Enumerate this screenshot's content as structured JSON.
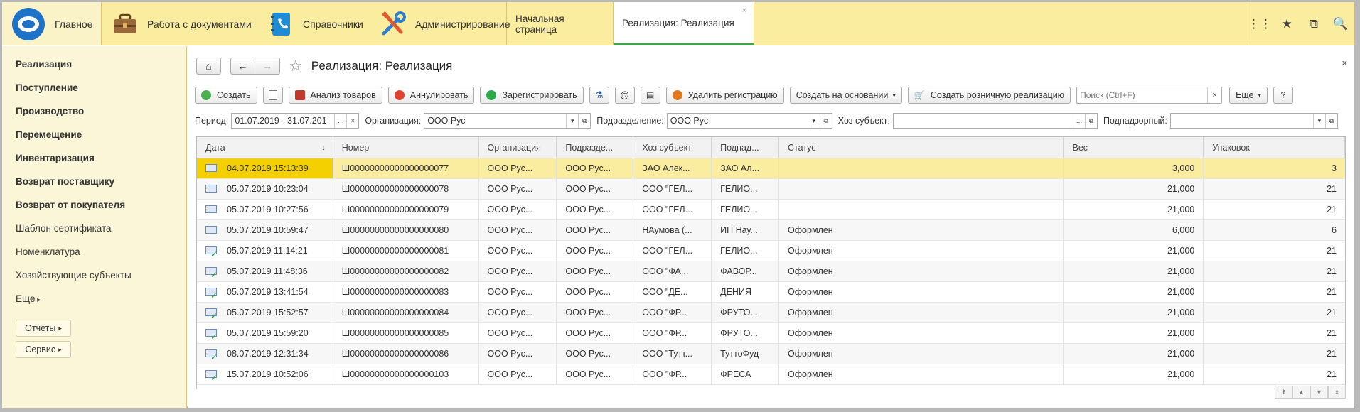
{
  "topbar": {
    "sections": [
      {
        "label": "Главное",
        "icon": "logo-icon"
      },
      {
        "label": "Работа с документами",
        "icon": "briefcase-icon"
      },
      {
        "label": "Справочники",
        "icon": "phonebook-icon"
      },
      {
        "label": "Администрирование",
        "icon": "tools-icon"
      }
    ],
    "open_tabs": [
      {
        "label": "Начальная страница"
      },
      {
        "label": "Реализация: Реализация",
        "close": "×"
      }
    ],
    "right_icons": [
      "grid-icon",
      "star-icon",
      "history-icon",
      "search-icon"
    ],
    "right_glyphs": [
      "⋮⋮",
      "★",
      "⧉",
      "🔍"
    ]
  },
  "sidebar": {
    "items": [
      {
        "label": "Реализация",
        "bold": true
      },
      {
        "label": "Поступление",
        "bold": true
      },
      {
        "label": "Производство",
        "bold": true
      },
      {
        "label": "Перемещение",
        "bold": true
      },
      {
        "label": "Инвентаризация",
        "bold": true
      },
      {
        "label": "Возврат поставщику",
        "bold": true
      },
      {
        "label": "Возврат от покупателя",
        "bold": true
      },
      {
        "label": "Шаблон сертификата",
        "bold": false
      },
      {
        "label": "Номенклатура",
        "bold": false
      },
      {
        "label": "Хозяйствующие субъекты",
        "bold": false
      }
    ],
    "more_label": "Еще",
    "reports_label": "Отчеты",
    "service_label": "Сервис"
  },
  "main": {
    "title": "Реализация: Реализация",
    "close": "×",
    "commands": {
      "create": "Создать",
      "analyze": "Анализ товаров",
      "cancel": "Аннулировать",
      "register": "Зарегистрировать",
      "email": "@",
      "delete_reg": "Удалить регистрацию",
      "create_based": "Создать на основании",
      "create_retail": "Создать розничную реализацию",
      "more": "Еще",
      "help": "?"
    },
    "search": {
      "placeholder": "Поиск (Ctrl+F)",
      "clear": "×"
    },
    "filters": {
      "period_label": "Период:",
      "period_value": "01.07.2019 - 31.07.201",
      "org_label": "Организация:",
      "org_value": "ООО Рус",
      "div_label": "Подразделение:",
      "div_value": "ООО Рус",
      "subject_label": "Хоз субъект:",
      "subject_value": "",
      "supervised_label": "Поднадзорный:",
      "supervised_value": ""
    },
    "columns": [
      "Дата",
      "Номер",
      "Организация",
      "Подразде...",
      "Хоз субъект",
      "Поднад...",
      "Статус",
      "Вес",
      "Упаковок"
    ],
    "sort_glyph": "↓",
    "rows": [
      {
        "date": "04.07.2019 15:13:39",
        "num": "Ш00000000000000000077",
        "org": "ООО Рус...",
        "div": "ООО Рус...",
        "sub": "ЗАО  Алек...",
        "sup": "ЗАО Ал...",
        "status": "",
        "weight": "3,000",
        "packs": "3",
        "posted": false,
        "selected": true
      },
      {
        "date": "05.07.2019 10:23:04",
        "num": "Ш00000000000000000078",
        "org": "ООО Рус...",
        "div": "ООО Рус...",
        "sub": "ООО \"ГЕЛ...",
        "sup": "ГЕЛИО...",
        "status": "",
        "weight": "21,000",
        "packs": "21",
        "posted": false
      },
      {
        "date": "05.07.2019 10:27:56",
        "num": "Ш00000000000000000079",
        "org": "ООО Рус...",
        "div": "ООО Рус...",
        "sub": "ООО \"ГЕЛ...",
        "sup": "ГЕЛИО...",
        "status": "",
        "weight": "21,000",
        "packs": "21",
        "posted": false
      },
      {
        "date": "05.07.2019 10:59:47",
        "num": "Ш00000000000000000080",
        "org": "ООО Рус...",
        "div": "ООО Рус...",
        "sub": "НАумова (...",
        "sup": "ИП Нау...",
        "status": "Оформлен",
        "weight": "6,000",
        "packs": "6",
        "posted": false
      },
      {
        "date": "05.07.2019 11:14:21",
        "num": "Ш00000000000000000081",
        "org": "ООО Рус...",
        "div": "ООО Рус...",
        "sub": "ООО \"ГЕЛ...",
        "sup": "ГЕЛИО...",
        "status": "Оформлен",
        "weight": "21,000",
        "packs": "21",
        "posted": true
      },
      {
        "date": "05.07.2019 11:48:36",
        "num": "Ш00000000000000000082",
        "org": "ООО Рус...",
        "div": "ООО Рус...",
        "sub": "ООО \"ФА...",
        "sup": "ФАВОР...",
        "status": "Оформлен",
        "weight": "21,000",
        "packs": "21",
        "posted": true
      },
      {
        "date": "05.07.2019 13:41:54",
        "num": "Ш00000000000000000083",
        "org": "ООО Рус...",
        "div": "ООО Рус...",
        "sub": "ООО \"ДЕ...",
        "sup": "ДЕНИЯ",
        "status": "Оформлен",
        "weight": "21,000",
        "packs": "21",
        "posted": true
      },
      {
        "date": "05.07.2019 15:52:57",
        "num": "Ш00000000000000000084",
        "org": "ООО Рус...",
        "div": "ООО Рус...",
        "sub": "ООО \"ФР...",
        "sup": "ФРУТО...",
        "status": "Оформлен",
        "weight": "21,000",
        "packs": "21",
        "posted": true
      },
      {
        "date": "05.07.2019 15:59:20",
        "num": "Ш00000000000000000085",
        "org": "ООО Рус...",
        "div": "ООО Рус...",
        "sub": "ООО \"ФР...",
        "sup": "ФРУТО...",
        "status": "Оформлен",
        "weight": "21,000",
        "packs": "21",
        "posted": true
      },
      {
        "date": "08.07.2019 12:31:34",
        "num": "Ш00000000000000000086",
        "org": "ООО Рус...",
        "div": "ООО Рус...",
        "sub": "ООО \"Тутт...",
        "sup": "ТуттоФуд",
        "status": "Оформлен",
        "weight": "21,000",
        "packs": "21",
        "posted": true
      },
      {
        "date": "15.07.2019 10:52:06",
        "num": "Ш00000000000000000103",
        "org": "ООО Рус...",
        "div": "ООО Рус...",
        "sub": "ООО \"ФР...",
        "sup": "ФРЕСА",
        "status": "Оформлен",
        "weight": "21,000",
        "packs": "21",
        "posted": true
      }
    ]
  },
  "colors": {
    "topbar_bg": "#fbeda0",
    "sidebar_bg": "#fbf6d7",
    "selection": "#fbeda0",
    "active_tab_accent": "#3aa84a"
  }
}
